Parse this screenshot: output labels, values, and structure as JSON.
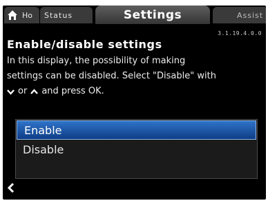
{
  "tabs": {
    "home": "Ho",
    "status": "Status",
    "settings": "Settings",
    "assist": "Assist"
  },
  "version": "3.1.19.4.0.0",
  "title": "Enable/disable settings",
  "description": {
    "line1": "In this display, the possibility of making",
    "line2": "settings can be disabled. Select \"Disable\" with",
    "line3_or": "or",
    "line3_rest": "and press OK."
  },
  "options": [
    "Enable",
    "Disable"
  ],
  "selected_option": "Enable",
  "icons": {
    "home": "home-icon",
    "down": "chevron-down-icon",
    "up": "chevron-up-icon",
    "back": "back-arrow-icon"
  },
  "colors": {
    "background": "#000000",
    "selection": "#1f5cb0",
    "text": "#ffffff"
  }
}
